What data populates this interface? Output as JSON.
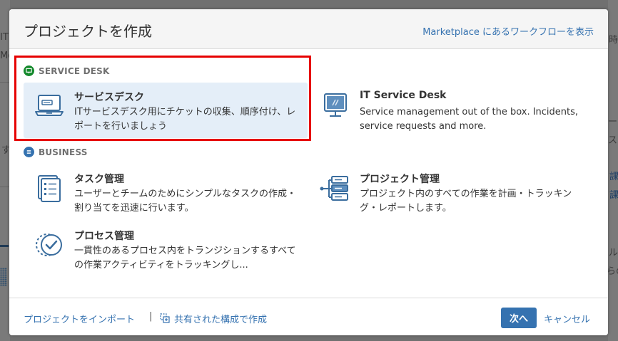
{
  "background": {
    "left_fragments": [
      "IT",
      "Me"
    ],
    "left_side_text": "す",
    "right_fragments": [
      "時",
      "ージ",
      "スタ",
      "課",
      "課",
      "ル",
      "らの"
    ]
  },
  "modal": {
    "title": "プロジェクトを作成",
    "marketplace_link": "Marketplace にあるワークフローを表示",
    "sections": [
      {
        "label": "SERVICE DESK",
        "color": "#14892c",
        "icon": "monitor-icon"
      },
      {
        "label": "BUSINESS",
        "color": "#3572b0",
        "icon": "list-icon"
      }
    ],
    "project_types": [
      {
        "title": "サービスデスク",
        "desc": "ITサービスデスク用にチケットの収集、順序付け、レポートを行いましょう",
        "icon": "laptop-icon",
        "selected": true
      },
      {
        "title": "IT Service Desk",
        "desc": "Service management out of the box. Incidents, service requests and more.",
        "icon": "monitor-screen-icon",
        "selected": false
      },
      {
        "title": "タスク管理",
        "desc": "ユーザーとチームのためにシンプルなタスクの作成・割り当てを迅速に行います。",
        "icon": "checklist-icon",
        "selected": false
      },
      {
        "title": "プロジェクト管理",
        "desc": "プロジェクト内のすべての作業を計画・トラッキング・レポートします。",
        "icon": "project-server-icon",
        "selected": false
      },
      {
        "title": "プロセス管理",
        "desc": "一貫性のあるプロセス内をトランジションするすべての作業アクティビティをトラッキングし...",
        "icon": "process-check-icon",
        "selected": false
      }
    ],
    "footer": {
      "import_link": "プロジェクトをインポート",
      "separator": "|",
      "shared_link": "共有された構成で作成",
      "next_button": "次へ",
      "cancel_link": "キャンセル"
    }
  },
  "colors": {
    "accent": "#3572b0",
    "highlight": "#e60000",
    "selected_bg": "#e4eef8"
  }
}
